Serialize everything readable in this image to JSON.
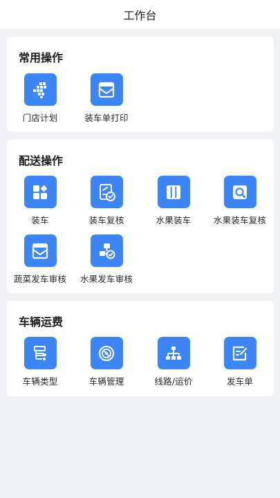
{
  "header": {
    "title": "工作台"
  },
  "sections": [
    {
      "title": "常用操作",
      "items": [
        {
          "label": "门店计划",
          "icon": "store-plan-icon"
        },
        {
          "label": "装车单打印",
          "icon": "print-envelope-icon"
        }
      ]
    },
    {
      "title": "配送操作",
      "items": [
        {
          "label": "装车",
          "icon": "grid-blocks-icon"
        },
        {
          "label": "装车复核",
          "icon": "document-check-icon"
        },
        {
          "label": "水果装车",
          "icon": "columns-icon"
        },
        {
          "label": "水果装车复核",
          "icon": "search-box-icon"
        },
        {
          "label": "蔬菜发车审核",
          "icon": "envelope-icon"
        },
        {
          "label": "水果发车审核",
          "icon": "flow-check-icon"
        }
      ]
    },
    {
      "title": "车辆运费",
      "items": [
        {
          "label": "车辆类型",
          "icon": "vehicle-type-icon"
        },
        {
          "label": "车辆管理",
          "icon": "steering-wheel-icon"
        },
        {
          "label": "线路/运价",
          "icon": "route-tree-icon"
        },
        {
          "label": "发车单",
          "icon": "edit-note-icon"
        }
      ]
    }
  ],
  "colors": {
    "accent": "#3d86f8",
    "background": "#f1f2f6"
  }
}
